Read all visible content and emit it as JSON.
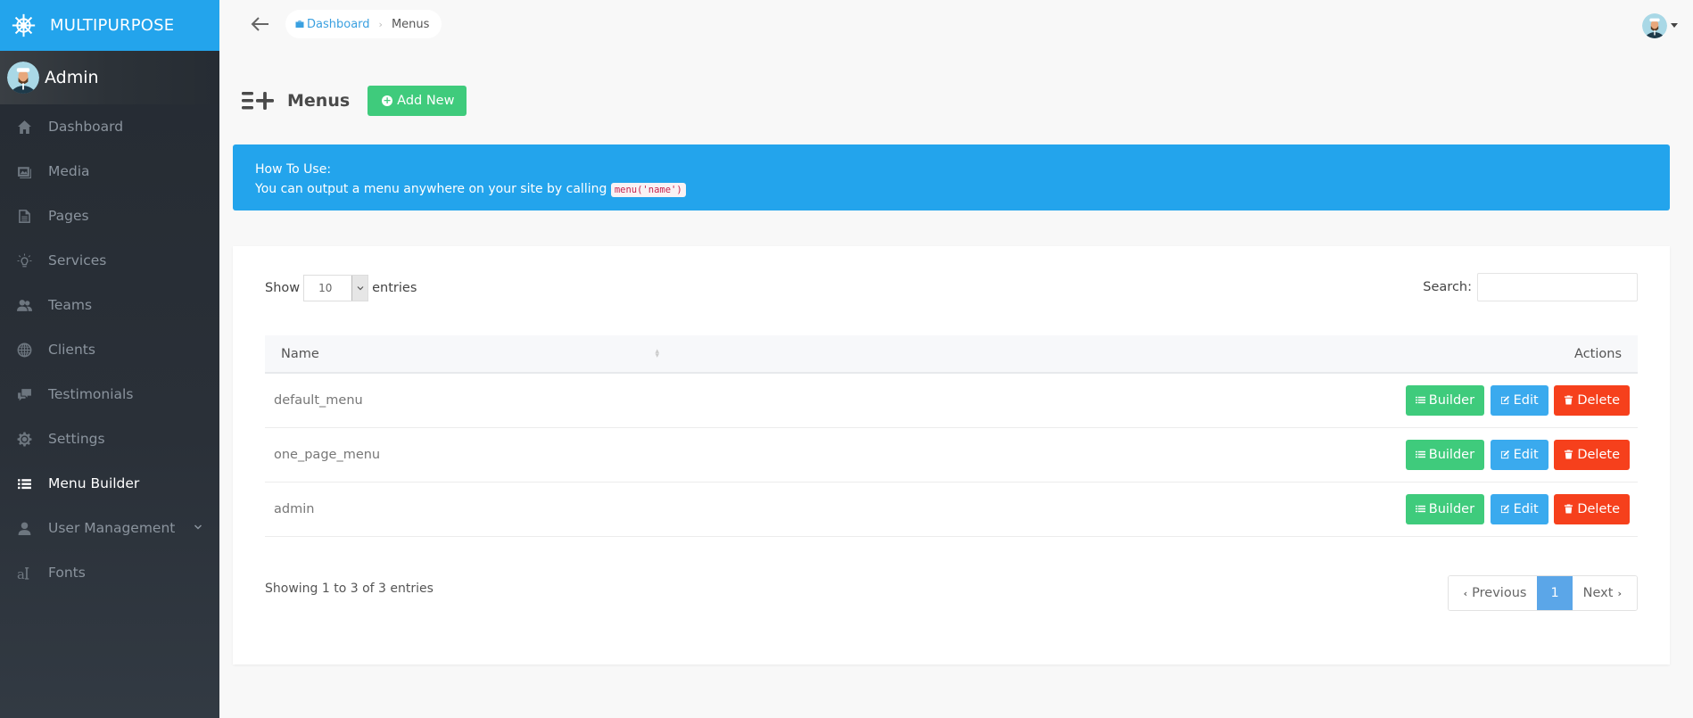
{
  "brand": {
    "name": "MULTIPURPOSE",
    "icon": "ship-wheel-icon"
  },
  "user": {
    "name": "Admin"
  },
  "sidebar": {
    "items": [
      {
        "label": "Dashboard",
        "icon": "home-icon",
        "active": false
      },
      {
        "label": "Media",
        "icon": "images-icon",
        "active": false
      },
      {
        "label": "Pages",
        "icon": "file-text-icon",
        "active": false
      },
      {
        "label": "Services",
        "icon": "lightbulb-icon",
        "active": false
      },
      {
        "label": "Teams",
        "icon": "users-icon",
        "active": false
      },
      {
        "label": "Clients",
        "icon": "globe-icon",
        "active": false
      },
      {
        "label": "Testimonials",
        "icon": "comments-icon",
        "active": false
      },
      {
        "label": "Settings",
        "icon": "gear-icon",
        "active": false
      },
      {
        "label": "Menu Builder",
        "icon": "list-icon",
        "active": true
      },
      {
        "label": "User Management",
        "icon": "user-icon",
        "active": false,
        "has_submenu": true
      },
      {
        "label": "Fonts",
        "icon": "font-icon",
        "active": false
      }
    ]
  },
  "breadcrumb": {
    "home": "Dashboard",
    "current": "Menus"
  },
  "page": {
    "title": "Menus",
    "add_button": "Add New"
  },
  "alert": {
    "title": "How To Use:",
    "text": "You can output a menu anywhere on your site by calling",
    "code": "menu('name')"
  },
  "table_controls": {
    "show_label": "Show",
    "entries_label": "entries",
    "page_length": "10",
    "search_label": "Search:",
    "search_value": ""
  },
  "table": {
    "columns": [
      "Name",
      "Actions"
    ],
    "rows": [
      {
        "name": "default_menu"
      },
      {
        "name": "one_page_menu"
      },
      {
        "name": "admin"
      }
    ],
    "row_actions": {
      "builder": "Builder",
      "edit": "Edit",
      "delete": "Delete"
    }
  },
  "footer": {
    "info": "Showing 1 to 3 of 3 entries",
    "previous": "Previous",
    "current_page": "1",
    "next": "Next"
  },
  "colors": {
    "brand": "#23a4ec",
    "success": "#3fcb7c",
    "info": "#3aaaee",
    "danger": "#f6401c",
    "page_active": "#5ba6e8"
  }
}
